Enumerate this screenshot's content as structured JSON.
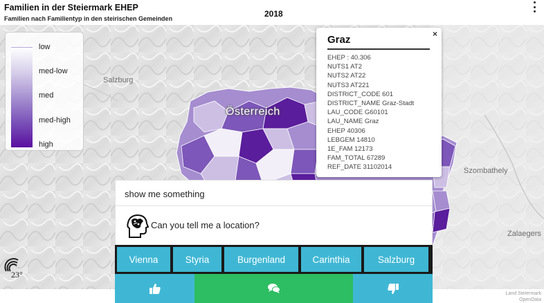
{
  "header": {
    "title": "Familien in der Steiermark EHEP",
    "subtitle": "Familien nach Familientyp in den steirischen Gemeinden",
    "year": "2018",
    "menu_icon": "kebab-menu-icon"
  },
  "map": {
    "labels": {
      "salzburg": "Salzburg",
      "austria": "Österreich",
      "szombathely": "Szombathely",
      "zalaegerszeg": "Zalaegers"
    },
    "colors": {
      "low": "#f2eff8",
      "med_low": "#cdbfe4",
      "med": "#a58dd0",
      "med_high": "#7d57b9",
      "high": "#5a1d9c"
    }
  },
  "legend": {
    "items": [
      "low",
      "med-low",
      "med",
      "med-high",
      "high"
    ]
  },
  "popup": {
    "title": "Graz",
    "close": "×",
    "rows": [
      "EHEP : 40.306",
      "NUTS1  AT2",
      "NUTS2  AT22",
      "NUTS3  AT221",
      "DISTRICT_CODE  601",
      "DISTRICT_NAME  Graz-Stadt",
      "LAU_CODE  G60101",
      "LAU_NAME  Graz",
      "EHEP  40306",
      "LEBGEM  14810",
      "1E_FAM  12173",
      "FAM_TOTAL  67289",
      "REF_DATE  31102014"
    ]
  },
  "chat": {
    "user_message": "show me something",
    "bot_message": "Can you tell me a location?",
    "choices": [
      "Vienna",
      "Styria",
      "Burgenland",
      "Carinthia",
      "Salzburg"
    ],
    "feedback": {
      "like_icon": "thumbs-up-icon",
      "comment_icon": "comments-icon",
      "dislike_icon": "thumbs-down-icon",
      "like_color": "#3fb7d4",
      "comment_color": "#2dbd62",
      "dislike_color": "#3fb7d4"
    }
  },
  "attribution": {
    "line1": "Land Steiermark",
    "line2": "OpenData"
  },
  "logo": {
    "text": "23°"
  }
}
